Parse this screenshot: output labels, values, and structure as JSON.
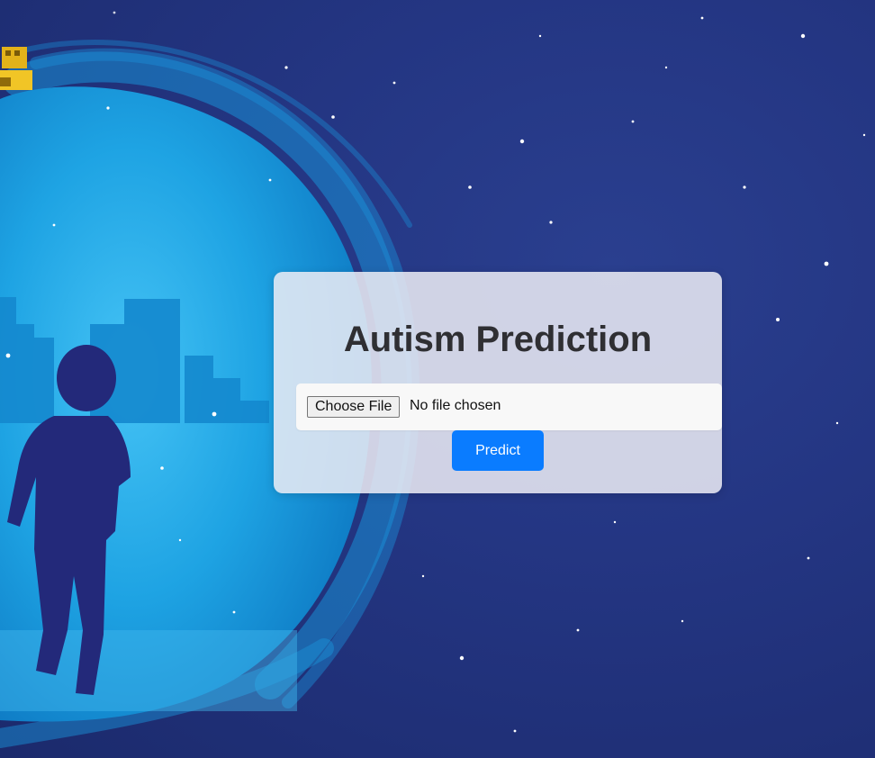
{
  "card": {
    "title": "Autism Prediction"
  },
  "file_input": {
    "button_label": "Choose File",
    "status_text": "No file chosen"
  },
  "predict_button": {
    "label": "Predict"
  },
  "colors": {
    "background_deep": "#1f2f76",
    "portal_blue": "#1ea7e6",
    "silhouette": "#23297a",
    "button_blue": "#0a7cff",
    "card": "#ececf4"
  },
  "icons": {
    "decoration": "robot-arm-icon"
  }
}
